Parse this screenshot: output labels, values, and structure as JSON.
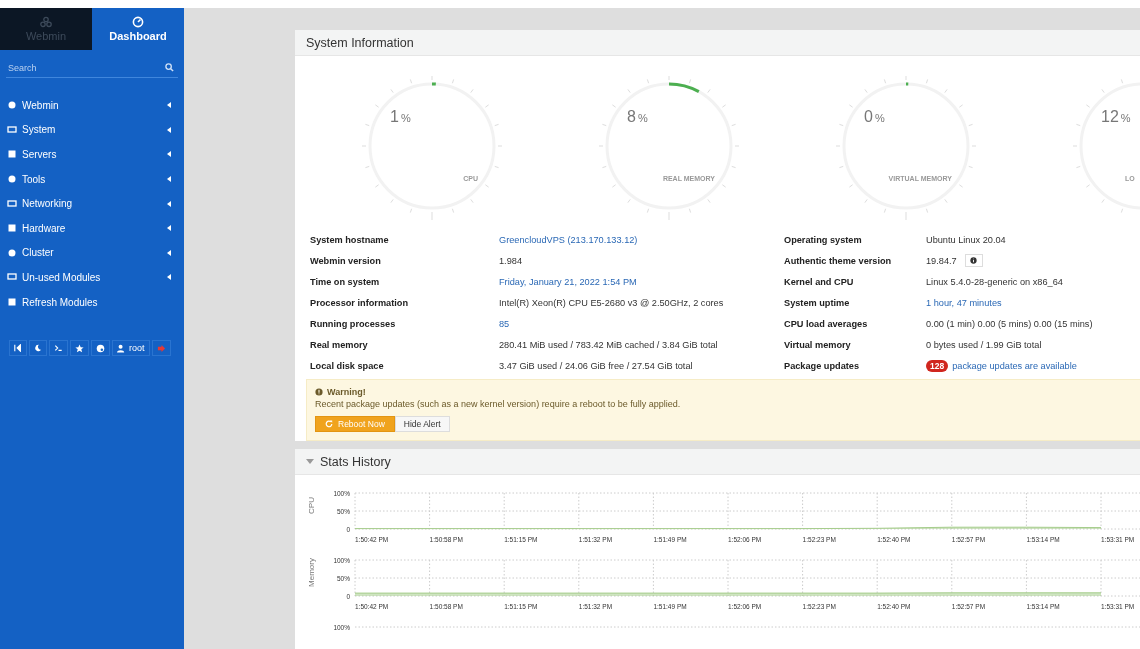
{
  "sidebar": {
    "tabs": [
      {
        "label": "Webmin",
        "selected": false
      },
      {
        "label": "Dashboard",
        "selected": true
      }
    ],
    "search": {
      "placeholder": "Search"
    },
    "items": [
      {
        "label": "Webmin",
        "expandable": true
      },
      {
        "label": "System",
        "expandable": true
      },
      {
        "label": "Servers",
        "expandable": true
      },
      {
        "label": "Tools",
        "expandable": true
      },
      {
        "label": "Networking",
        "expandable": true
      },
      {
        "label": "Hardware",
        "expandable": true
      },
      {
        "label": "Cluster",
        "expandable": true
      },
      {
        "label": "Un-used Modules",
        "expandable": true
      },
      {
        "label": "Refresh Modules",
        "expandable": false
      }
    ],
    "toolbar": {
      "user": "root"
    }
  },
  "system_information": {
    "title": "System Information",
    "gauges": [
      {
        "value": "1",
        "unit": "%",
        "label": "CPU",
        "level": 0.01
      },
      {
        "value": "8",
        "unit": "%",
        "label": "REAL MEMORY",
        "level": 0.08
      },
      {
        "value": "0",
        "unit": "%",
        "label": "VIRTUAL MEMORY",
        "level": 0.004
      },
      {
        "value": "12",
        "unit": "%",
        "label": "LO",
        "cut_off": true
      }
    ],
    "rows": [
      {
        "label": "System hostname",
        "value": "GreencloudVPS (213.170.133.12)",
        "link": true
      },
      {
        "label": "Operating system",
        "value": "Ubuntu Linux 20.04",
        "link": false
      },
      {
        "label": "Webmin version",
        "value": "1.984",
        "link": false
      },
      {
        "label": "Authentic theme version",
        "value": "19.84.7",
        "link": false,
        "info": true
      },
      {
        "label": "Time on system",
        "value": "Friday, January 21, 2022 1:54 PM",
        "link": true
      },
      {
        "label": "Kernel and CPU",
        "value": "Linux 5.4.0-28-generic on x86_64",
        "link": false
      },
      {
        "label": "Processor information",
        "value": "Intel(R) Xeon(R) CPU E5-2680 v3 @ 2.50GHz, 2 cores",
        "link": false
      },
      {
        "label": "System uptime",
        "value": "1 hour, 47 minutes",
        "link": true
      },
      {
        "label": "Running processes",
        "value": "85",
        "link": true
      },
      {
        "label": "CPU load averages",
        "value": "0.00 (1 min) 0.00 (5 mins) 0.00 (15 mins)",
        "link": false
      },
      {
        "label": "Real memory",
        "value": "280.41 MiB used / 783.42 MiB cached / 3.84 GiB total",
        "link": false
      },
      {
        "label": "Virtual memory",
        "value": "0 bytes used / 1.99 GiB total",
        "link": false
      },
      {
        "label": "Local disk space",
        "value": "3.47 GiB used / 24.06 GiB free / 27.54 GiB total",
        "link": false
      },
      {
        "label": "Package updates",
        "value": "package updates are available",
        "link": true,
        "badge": "128"
      }
    ],
    "warning": {
      "title": "Warning!",
      "message": "Recent package updates (such as a new kernel version) require a reboot to be fully applied.",
      "buttons": [
        "Reboot Now",
        "Hide Alert"
      ]
    }
  },
  "stats_history": {
    "title": "Stats History",
    "expanded": true,
    "charts": [
      {
        "chart_data": {
          "type": "area",
          "categories": [
            "1:50:42 PM",
            "1:50:58 PM",
            "1:51:15 PM",
            "1:51:32 PM",
            "1:51:49 PM",
            "1:52:06 PM",
            "1:52:23 PM",
            "1:52:40 PM",
            "1:52:57 PM",
            "1:53:14 PM",
            "1:53:31 PM"
          ],
          "yticks": [
            {
              "value": 0,
              "label": "0"
            },
            {
              "value": 50,
              "label": "50%"
            },
            {
              "value": 100,
              "label": "100%"
            }
          ],
          "ylim": [
            0,
            100
          ],
          "series": [
            {
              "name": "CPU",
              "color": "#a6cd8c",
              "values": [
                1,
                1,
                1,
                1,
                1,
                1,
                1,
                2,
                5,
                5,
                4
              ]
            }
          ]
        }
      },
      {
        "chart_data": {
          "type": "area",
          "categories": [
            "1:50:42 PM",
            "1:50:58 PM",
            "1:51:15 PM",
            "1:51:32 PM",
            "1:51:49 PM",
            "1:52:06 PM",
            "1:52:23 PM",
            "1:52:40 PM",
            "1:52:57 PM",
            "1:53:14 PM",
            "1:53:31 PM"
          ],
          "yticks": [
            {
              "value": 0,
              "label": "0"
            },
            {
              "value": 50,
              "label": "50%"
            },
            {
              "value": 100,
              "label": "100%"
            }
          ],
          "ylim": [
            0,
            100
          ],
          "series": [
            {
              "name": "Memory",
              "color": "#a6cd8c",
              "values": [
                8,
                8,
                8,
                8,
                8,
                8,
                8,
                8,
                9,
                9,
                9
              ]
            }
          ]
        }
      },
      {
        "top_tick": "100%"
      }
    ]
  }
}
